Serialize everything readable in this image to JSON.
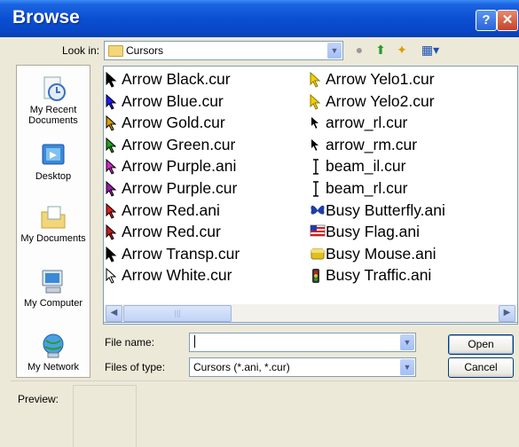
{
  "window": {
    "title": "Browse"
  },
  "titlebar_buttons": {
    "help": "?",
    "close": "✕"
  },
  "lookin": {
    "label": "Look in:",
    "value": "Cursors"
  },
  "places": [
    {
      "label": "My Recent Documents"
    },
    {
      "label": "Desktop"
    },
    {
      "label": "My Documents"
    },
    {
      "label": "My Computer"
    },
    {
      "label": "My Network"
    }
  ],
  "files_left": [
    {
      "name": "Arrow Black.cur",
      "color": "#000000"
    },
    {
      "name": "Arrow Blue.cur",
      "color": "#1a1aff"
    },
    {
      "name": "Arrow Gold.cur",
      "color": "#d9a000"
    },
    {
      "name": "Arrow Green.cur",
      "color": "#1aa51a"
    },
    {
      "name": "Arrow Purple.ani",
      "color": "#cc2ac4"
    },
    {
      "name": "Arrow Purple.cur",
      "color": "#9a1aa8"
    },
    {
      "name": "Arrow Red.ani",
      "color": "#e01a1a"
    },
    {
      "name": "Arrow Red.cur",
      "color": "#c41a1a"
    },
    {
      "name": "Arrow Transp.cur",
      "color": "#000000"
    },
    {
      "name": "Arrow White.cur",
      "color": "#ffffff"
    }
  ],
  "files_right": [
    {
      "name": "Arrow Yelo1.cur",
      "icon": "arrow-yellow-icon"
    },
    {
      "name": "Arrow Yelo2.cur",
      "icon": "arrow-yellow-icon"
    },
    {
      "name": "arrow_rl.cur",
      "icon": "arrow-black-icon"
    },
    {
      "name": "arrow_rm.cur",
      "icon": "arrow-black-icon"
    },
    {
      "name": "beam_il.cur",
      "icon": "ibeam-icon"
    },
    {
      "name": "beam_rl.cur",
      "icon": "ibeam-icon"
    },
    {
      "name": "Busy Butterfly.ani",
      "icon": "butterfly-icon"
    },
    {
      "name": "Busy Flag.ani",
      "icon": "flag-icon"
    },
    {
      "name": "Busy Mouse.ani",
      "icon": "mouse-icon"
    },
    {
      "name": "Busy Traffic.ani",
      "icon": "traffic-light-icon"
    }
  ],
  "filename": {
    "label": "File name:",
    "value": ""
  },
  "filetype": {
    "label": "Files of type:",
    "value": "Cursors (*.ani, *.cur)"
  },
  "buttons": {
    "open": "Open",
    "cancel": "Cancel"
  },
  "preview": {
    "label": "Preview:"
  },
  "colors": {
    "titlebar": "#0a4fd2",
    "dialog_bg": "#ece9d8",
    "border": "#7f9db9"
  }
}
